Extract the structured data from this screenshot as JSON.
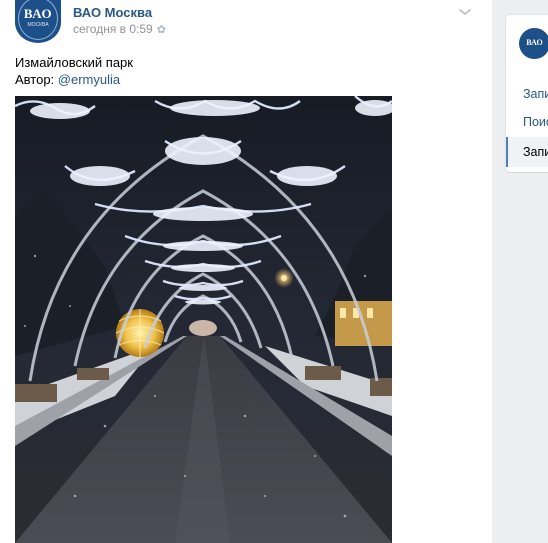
{
  "post": {
    "author": "ВАО Москва",
    "date": "сегодня в 0:59",
    "avatar_text_main": "ВАО",
    "avatar_text_sub": "МОСКВА",
    "text_line1": "Измайловский парк",
    "text_author_prefix": "Автор: ",
    "text_author_link": "@ermyulia",
    "photo_icon": "night-park-light-tunnel-photo"
  },
  "right_menu": {
    "avatar_text": "ВАО",
    "items": [
      {
        "label": "Запи"
      },
      {
        "label": "Поис"
      },
      {
        "label": "Запи"
      }
    ]
  },
  "icons": {
    "settings": "gear-icon",
    "more": "chevron-down-icon"
  },
  "colors": {
    "link": "#2a5885",
    "brand": "#1d4f88",
    "background": "#edeef0"
  }
}
